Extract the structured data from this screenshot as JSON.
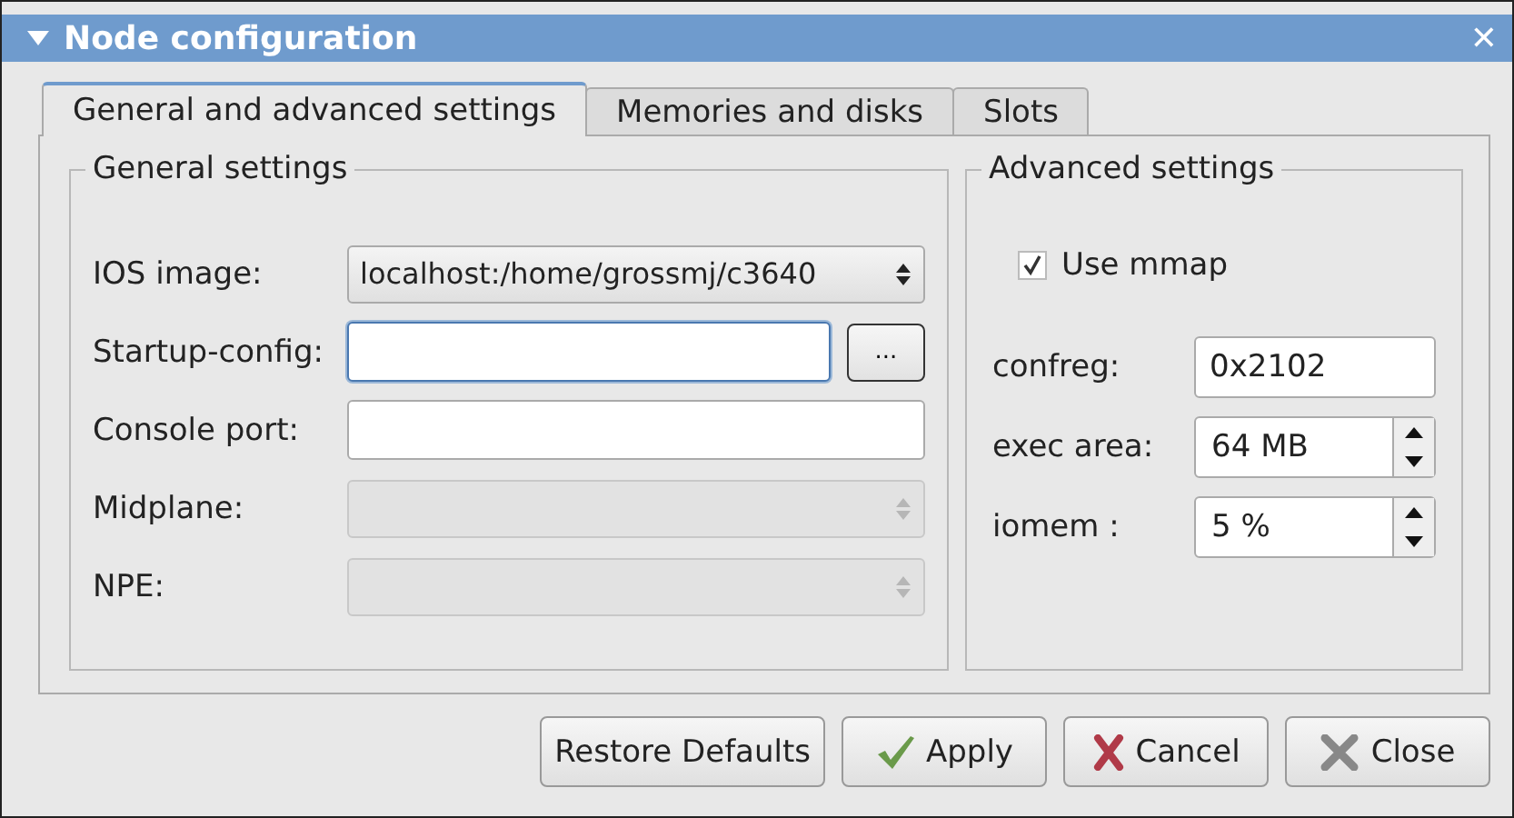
{
  "window": {
    "title": "Node configuration",
    "close": "✕"
  },
  "tabs": [
    {
      "label": "General and advanced settings",
      "selected": true
    },
    {
      "label": "Memories and disks",
      "selected": false
    },
    {
      "label": "Slots",
      "selected": false
    }
  ],
  "general": {
    "title": "General settings",
    "fields": [
      {
        "label": "IOS image:",
        "kind": "combo",
        "value": "localhost:/home/grossmj/c3640",
        "disabled": false
      },
      {
        "label": "Startup-config:",
        "kind": "file",
        "browse": "...",
        "focused": true
      },
      {
        "label": "Console port:",
        "kind": "text",
        "focused": false
      },
      {
        "label": "Midplane:",
        "kind": "combo",
        "disabled": true
      },
      {
        "label": "NPE:",
        "kind": "combo",
        "disabled": true
      }
    ]
  },
  "advanced": {
    "title": "Advanced settings",
    "use_mmap": {
      "label": "Use mmap",
      "checked": true
    },
    "fields": [
      {
        "label": "confreg:",
        "kind": "text",
        "value": "0x2102"
      },
      {
        "label": "exec area:",
        "kind": "spin",
        "value": "64 MB"
      },
      {
        "label": "iomem :",
        "kind": "spin",
        "value": "5 %"
      }
    ]
  },
  "buttons": [
    {
      "label": "Restore Defaults",
      "kind": "plain"
    },
    {
      "label": "Apply",
      "kind": "apply"
    },
    {
      "label": "Cancel",
      "kind": "cancel"
    },
    {
      "label": "Close",
      "kind": "close"
    }
  ]
}
